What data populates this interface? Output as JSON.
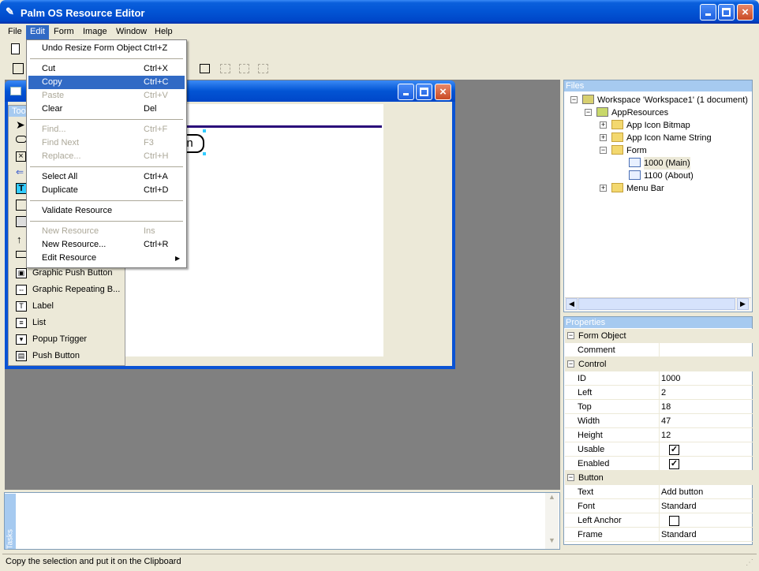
{
  "window": {
    "title": "Palm OS Resource Editor"
  },
  "menubar": [
    "File",
    "Edit",
    "Form",
    "Image",
    "Window",
    "Help"
  ],
  "edit_menu": [
    {
      "label": "Undo Resize Form Object",
      "shortcut": "Ctrl+Z",
      "enabled": true
    },
    {
      "sep": true
    },
    {
      "label": "Cut",
      "shortcut": "Ctrl+X",
      "enabled": true
    },
    {
      "label": "Copy",
      "shortcut": "Ctrl+C",
      "enabled": true,
      "highlighted": true
    },
    {
      "label": "Paste",
      "shortcut": "Ctrl+V",
      "enabled": false
    },
    {
      "label": "Clear",
      "shortcut": "Del",
      "enabled": true
    },
    {
      "sep": true
    },
    {
      "label": "Find...",
      "shortcut": "Ctrl+F",
      "enabled": false
    },
    {
      "label": "Find Next",
      "shortcut": "F3",
      "enabled": false
    },
    {
      "label": "Replace...",
      "shortcut": "Ctrl+H",
      "enabled": false
    },
    {
      "sep": true
    },
    {
      "label": "Select All",
      "shortcut": "Ctrl+A",
      "enabled": true
    },
    {
      "label": "Duplicate",
      "shortcut": "Ctrl+D",
      "enabled": true
    },
    {
      "sep": true
    },
    {
      "label": "Validate Resource",
      "shortcut": "",
      "enabled": true
    },
    {
      "sep": true
    },
    {
      "label": "New Resource",
      "shortcut": "Ins",
      "enabled": false
    },
    {
      "label": "New Resource...",
      "shortcut": "Ctrl+R",
      "enabled": true
    },
    {
      "label": "Edit Resource",
      "shortcut": "",
      "enabled": true,
      "submenu": true
    }
  ],
  "toolbox": {
    "title_fragment": "Too",
    "items": [
      {
        "label": "Graphic Push Button",
        "icon": "graphic-push-button-icon",
        "glyph": "▣"
      },
      {
        "label": "Graphic Repeating B...",
        "icon": "graphic-repeating-button-icon",
        "glyph": "⇔"
      },
      {
        "label": "Label",
        "icon": "label-icon",
        "glyph": "T"
      },
      {
        "label": "List",
        "icon": "list-icon",
        "glyph": "≡"
      },
      {
        "label": "Popup Trigger",
        "icon": "popup-trigger-icon",
        "glyph": "▾"
      },
      {
        "label": "Push Button",
        "icon": "push-button-icon",
        "glyph": "▤"
      }
    ]
  },
  "form_canvas": {
    "button_fragment": "on"
  },
  "files": {
    "header": "Files",
    "tree": [
      {
        "label": "Workspace 'Workspace1' (1 document)",
        "depth": 0,
        "expander": "−",
        "icon": "workspace-icon"
      },
      {
        "label": "AppResources",
        "depth": 1,
        "expander": "−",
        "icon": "resource-file-icon"
      },
      {
        "label": "App Icon Bitmap",
        "depth": 2,
        "expander": "+",
        "icon": "folder-icon"
      },
      {
        "label": "App Icon Name String",
        "depth": 2,
        "expander": "+",
        "icon": "folder-icon"
      },
      {
        "label": "Form",
        "depth": 2,
        "expander": "−",
        "icon": "folder-icon"
      },
      {
        "label": "1000 (Main)",
        "depth": 3,
        "expander": "",
        "icon": "form-resource-icon",
        "selected": true
      },
      {
        "label": "1100 (About)",
        "depth": 3,
        "expander": "",
        "icon": "form-resource-icon"
      },
      {
        "label": "Menu Bar",
        "depth": 2,
        "expander": "+",
        "icon": "folder-icon"
      }
    ]
  },
  "properties": {
    "header": "Properties",
    "rows": [
      {
        "group": true,
        "label": "Form Object"
      },
      {
        "label": "Comment",
        "value": ""
      },
      {
        "group": true,
        "label": "Control"
      },
      {
        "label": "ID",
        "value": "1000"
      },
      {
        "label": "Left",
        "value": "2"
      },
      {
        "label": "Top",
        "value": "18"
      },
      {
        "label": "Width",
        "value": "47"
      },
      {
        "label": "Height",
        "value": "12"
      },
      {
        "label": "Usable",
        "checkbox": true,
        "checked": true
      },
      {
        "label": "Enabled",
        "checkbox": true,
        "checked": true
      },
      {
        "group": true,
        "label": "Button"
      },
      {
        "label": "Text",
        "value": "Add button"
      },
      {
        "label": "Font",
        "value": "Standard"
      },
      {
        "label": "Left Anchor",
        "checkbox": true,
        "checked": false
      },
      {
        "label": "Frame",
        "value": "Standard"
      }
    ]
  },
  "tasks": {
    "label": "Tasks"
  },
  "status": {
    "text": "Copy the selection and put it on the Clipboard"
  },
  "colors": {
    "titlebar": "#0254d4",
    "menu_highlight": "#316ac5",
    "mdi_background": "#808080",
    "panel_header": "#a6caf0"
  }
}
